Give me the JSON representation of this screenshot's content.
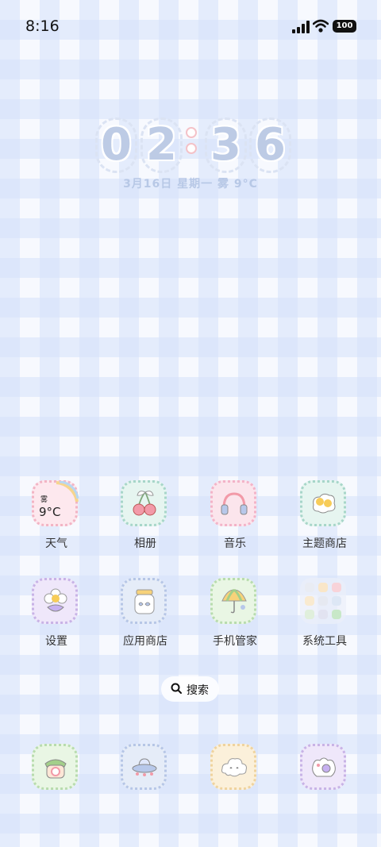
{
  "status_bar": {
    "time": "8:16",
    "battery": "100"
  },
  "lock_clock": {
    "digits": [
      "0",
      "2",
      "3",
      "6"
    ],
    "date_line": "3月16日  星期一  雾  9°C"
  },
  "weather_widget": {
    "condition": "雾",
    "temp": "9°C"
  },
  "apps_row1": [
    {
      "label": "天气",
      "icon": "weather-icon",
      "border": "#f2b4c4",
      "bg": "#fde8ee"
    },
    {
      "label": "相册",
      "icon": "cherry-icon",
      "border": "#a7d6c9",
      "bg": "#e6f5f0"
    },
    {
      "label": "音乐",
      "icon": "headphones-icon",
      "border": "#f3b3c8",
      "bg": "#fbe5ec"
    },
    {
      "label": "主题商店",
      "icon": "egg-icon",
      "border": "#a7d6c9",
      "bg": "#e6f5f0"
    }
  ],
  "apps_row2": [
    {
      "label": "设置",
      "icon": "flower-icon",
      "border": "#c8b3e6",
      "bg": "#efe7fa"
    },
    {
      "label": "应用商店",
      "icon": "jar-icon",
      "border": "#b6c6e6",
      "bg": "#e5ecf8"
    },
    {
      "label": "手机管家",
      "icon": "umbrella-icon",
      "border": "#b8dcae",
      "bg": "#e9f6e4"
    },
    {
      "label": "系统工具",
      "icon": "folder-icon",
      "border": "none",
      "bg": "transparent"
    }
  ],
  "search": {
    "label": "搜索"
  },
  "dock": [
    {
      "icon": "phone-icon",
      "border": "#b8dcae",
      "bg": "#e9f6e4"
    },
    {
      "icon": "ufo-icon",
      "border": "#b6c6e6",
      "bg": "#e5ecf8"
    },
    {
      "icon": "cloud-icon",
      "border": "#efd39e",
      "bg": "#fbf0da"
    },
    {
      "icon": "camera-icon",
      "border": "#c8b3e6",
      "bg": "#efe7fa"
    }
  ]
}
